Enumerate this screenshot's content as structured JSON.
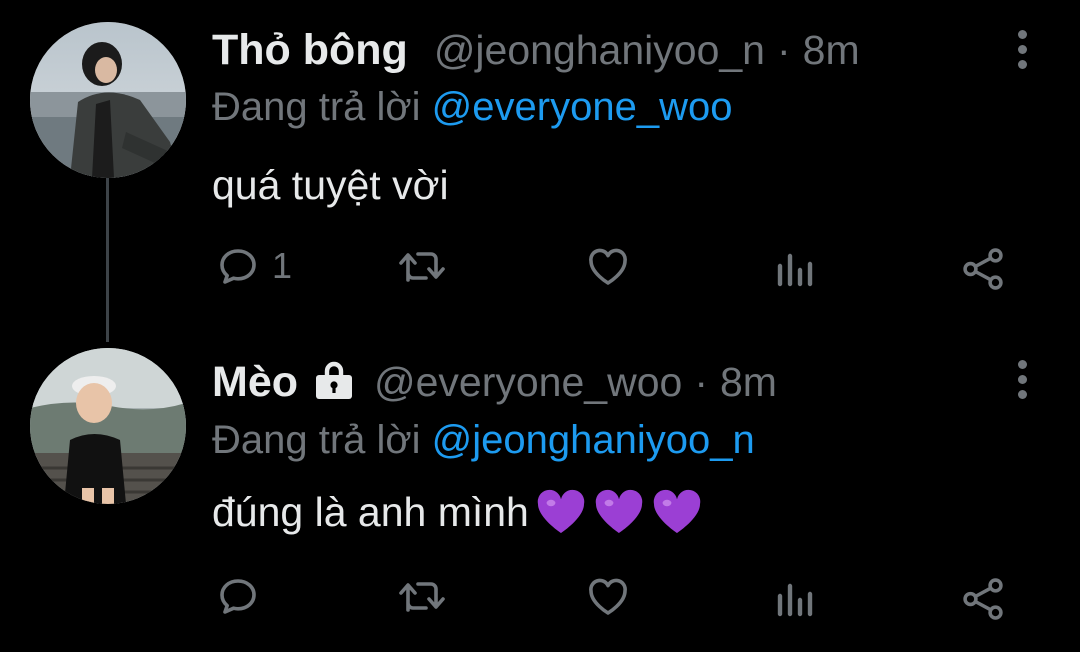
{
  "colors": {
    "background": "#000000",
    "text": "#e7e9ea",
    "secondary": "#71767b",
    "mention": "#1d9bf0",
    "heart_emoji": "#9b3fd4",
    "thread_line": "#3d4348"
  },
  "tweets": [
    {
      "name": "Thỏ bông",
      "handle": "@jeonghaniyoo_n",
      "separator": "·",
      "time": "8m",
      "locked": false,
      "reply_prefix": "Đang trả lời",
      "reply_to": "@everyone_woo",
      "text": "quá tuyệt vời",
      "emojis": [],
      "reply_count": "1",
      "icons": [
        "reply-icon",
        "retweet-icon",
        "like-icon",
        "analytics-icon",
        "share-icon",
        "more-icon"
      ]
    },
    {
      "name": "Mèo",
      "handle": "@everyone_woo",
      "separator": "·",
      "time": "8m",
      "locked": true,
      "reply_prefix": "Đang trả lời",
      "reply_to": "@jeonghaniyoo_n",
      "text": "đúng là anh mình",
      "emojis": [
        "purple-heart",
        "purple-heart",
        "purple-heart"
      ],
      "reply_count": "",
      "icons": [
        "reply-icon",
        "retweet-icon",
        "like-icon",
        "analytics-icon",
        "share-icon",
        "more-icon"
      ]
    }
  ]
}
